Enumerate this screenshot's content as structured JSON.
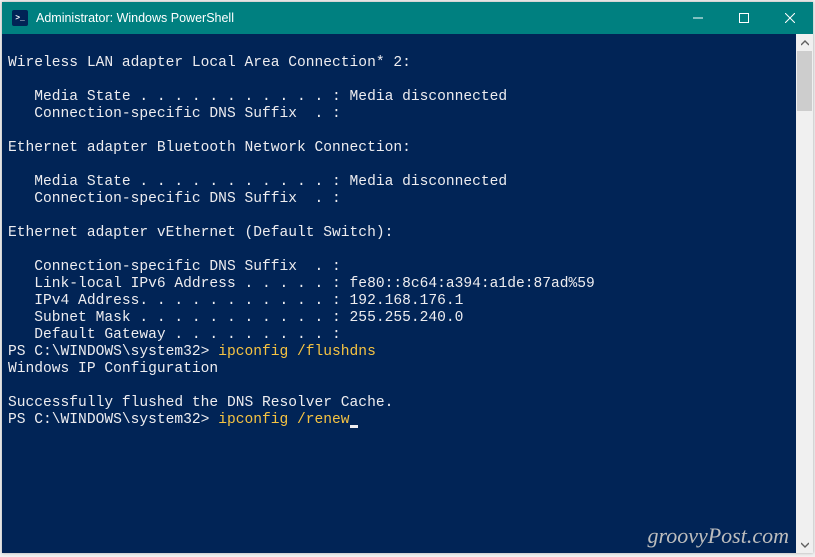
{
  "titlebar": {
    "icon_label": ">_",
    "title": "Administrator: Windows PowerShell"
  },
  "console": {
    "output": "\nWireless LAN adapter Local Area Connection* 2:\n\n   Media State . . . . . . . . . . . : Media disconnected\n   Connection-specific DNS Suffix  . :\n\nEthernet adapter Bluetooth Network Connection:\n\n   Media State . . . . . . . . . . . : Media disconnected\n   Connection-specific DNS Suffix  . :\n\nEthernet adapter vEthernet (Default Switch):\n\n   Connection-specific DNS Suffix  . :\n   Link-local IPv6 Address . . . . . : fe80::8c64:a394:a1de:87ad%59\n   IPv4 Address. . . . . . . . . . . : 192.168.176.1\n   Subnet Mask . . . . . . . . . . . : 255.255.240.0\n   Default Gateway . . . . . . . . . :",
    "history_prompt": "PS C:\\WINDOWS\\system32> ",
    "history_cmd": "ipconfig /flushdns",
    "output2": "\nWindows IP Configuration\n\nSuccessfully flushed the DNS Resolver Cache.",
    "current_prompt": "PS C:\\WINDOWS\\system32> ",
    "current_cmd": "ipconfig /renew"
  },
  "watermark": "groovyPost.com"
}
